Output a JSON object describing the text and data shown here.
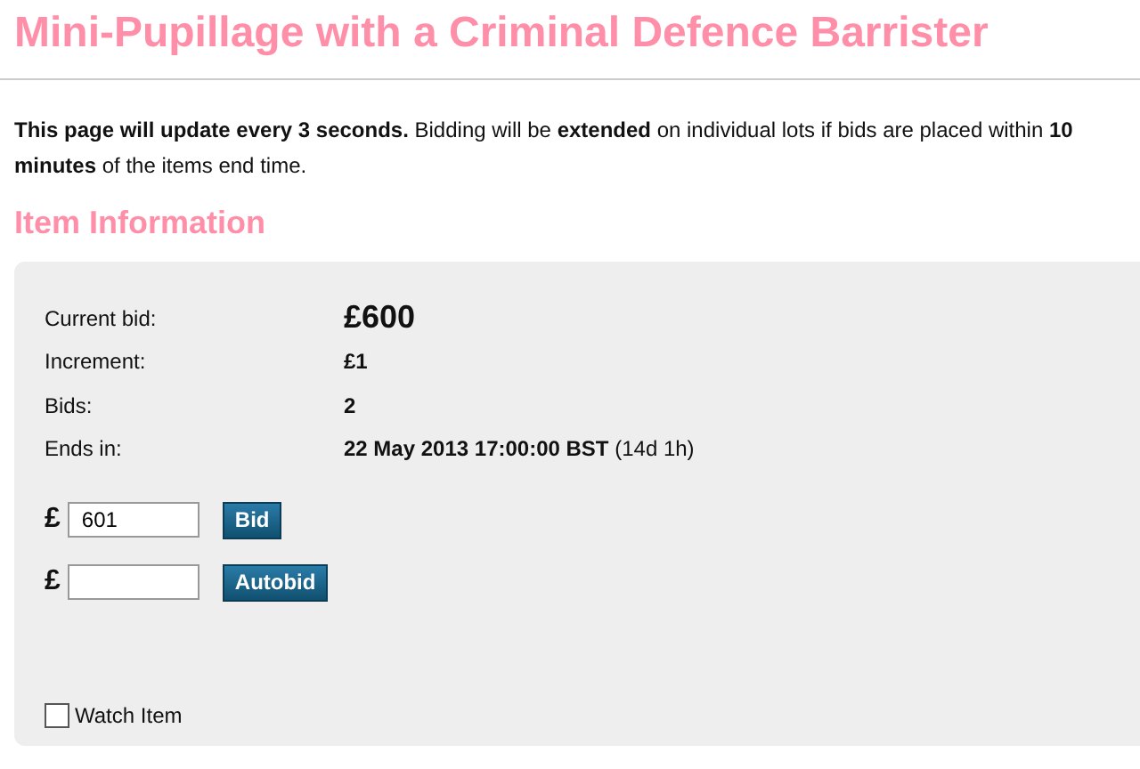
{
  "title": "Mini-Pupillage with a Criminal Defence Barrister",
  "notice": "**This page will update every 3 seconds.** Bidding will be **extended** on individual lots if bids are placed within **10 minutes** of the items end time.",
  "section_heading": "Item Information",
  "details": [
    {
      "label": "Current bid:",
      "value": "£600",
      "kind": "large"
    },
    {
      "label": "Increment:",
      "value": "£1",
      "kind": "bold"
    },
    {
      "label": "Bids:",
      "value": "2",
      "kind": "bold"
    },
    {
      "label": "Ends in:",
      "value": "**22 May 2013 17:00:00 BST** (14d 1h)",
      "kind": "rich"
    }
  ],
  "bid_forms": [
    {
      "currency": "£",
      "value": "601",
      "button": "Bid"
    },
    {
      "currency": "£",
      "button": "Autobid"
    }
  ],
  "watch": {
    "label": "Watch Item",
    "checked": false
  }
}
